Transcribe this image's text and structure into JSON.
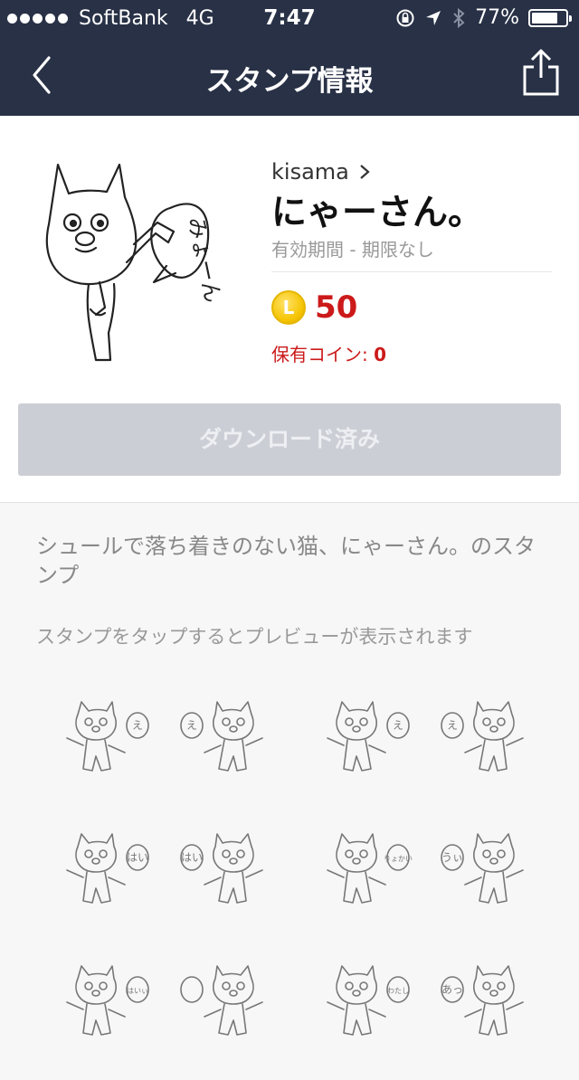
{
  "status_bar": {
    "carrier": "SoftBank",
    "network": "4G",
    "time": "7:47",
    "battery": "77%",
    "battery_level": 0.77
  },
  "nav": {
    "title": "スタンプ情報",
    "back_icon": "chevron-left-icon",
    "share_icon": "share-icon"
  },
  "sticker": {
    "preview_text": "みょーん",
    "creator": "kisama",
    "name": "にゃーさん。",
    "validity": "有効期間 - 期限なし",
    "coin_icon_label": "L",
    "price": "50",
    "owned_label": "保有コイン: ",
    "owned_value": "0",
    "download_label": "ダウンロード済み",
    "description": "シュールで落ち着きのない猫、にゃーさん。のスタンプ",
    "preview_hint": "スタンプをタップするとプレビューが表示されます"
  },
  "grid_labels": [
    "え",
    "え",
    "え",
    "え",
    "はい",
    "はい",
    "りょかい",
    "うぃ",
    "はいぃ",
    "",
    "わたし",
    "あっ"
  ],
  "colors": {
    "header_bg": "#283146",
    "price_red": "#cc1a1a",
    "coin_gold": "#f5c400",
    "disabled_button": "#ccced6"
  }
}
